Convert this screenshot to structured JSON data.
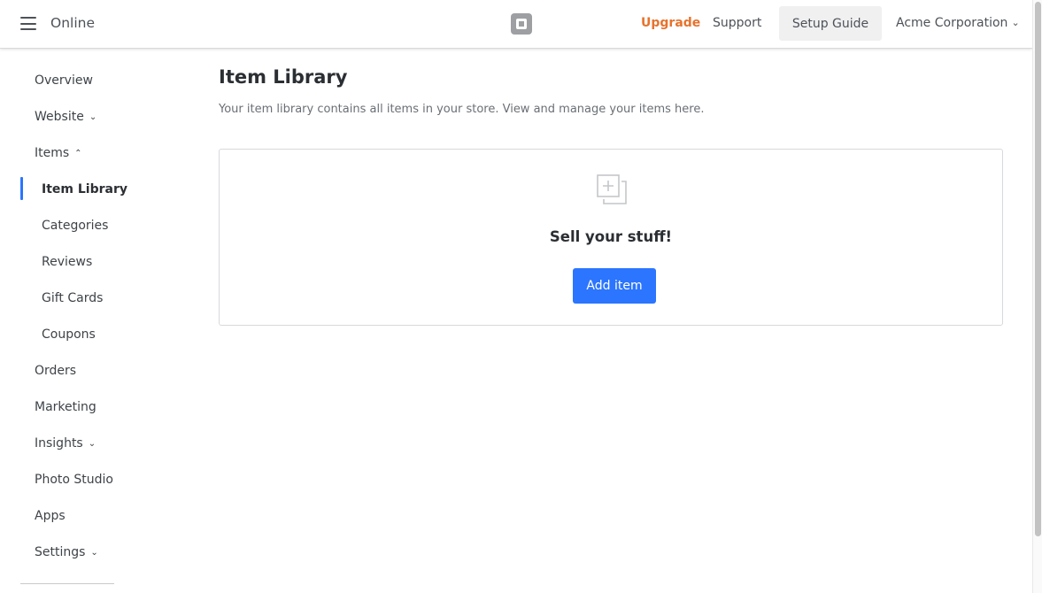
{
  "header": {
    "app_title": "Online",
    "menu_icon": "hamburger-menu-icon",
    "logo_icon": "square-logo-icon",
    "upgrade_label": "Upgrade",
    "support_label": "Support",
    "setup_guide_label": "Setup Guide",
    "account_label": "Acme Corporation",
    "account_chevron_icon": "chevron-down-icon",
    "accent_color": "#e8722c"
  },
  "sidebar": {
    "items": [
      {
        "label": "Overview"
      },
      {
        "label": "Website",
        "chevron": "⌄"
      },
      {
        "label": "Items",
        "chevron": "⌃"
      },
      {
        "label": "Item Library",
        "active": true
      },
      {
        "label": "Categories"
      },
      {
        "label": "Reviews"
      },
      {
        "label": "Gift Cards"
      },
      {
        "label": "Coupons"
      },
      {
        "label": "Orders"
      },
      {
        "label": "Marketing"
      },
      {
        "label": "Insights",
        "chevron": "⌄"
      },
      {
        "label": "Photo Studio"
      },
      {
        "label": "Apps"
      },
      {
        "label": "Settings",
        "chevron": "⌄"
      }
    ],
    "active_color": "#2b75ff"
  },
  "main": {
    "title": "Item Library",
    "description": "Your item library contains all items in your store. View and manage your items here.",
    "empty_state": {
      "icon": "add-item-icon",
      "heading": "Sell your stuff!",
      "button_label": "Add item",
      "button_color": "#2b75ff"
    }
  }
}
